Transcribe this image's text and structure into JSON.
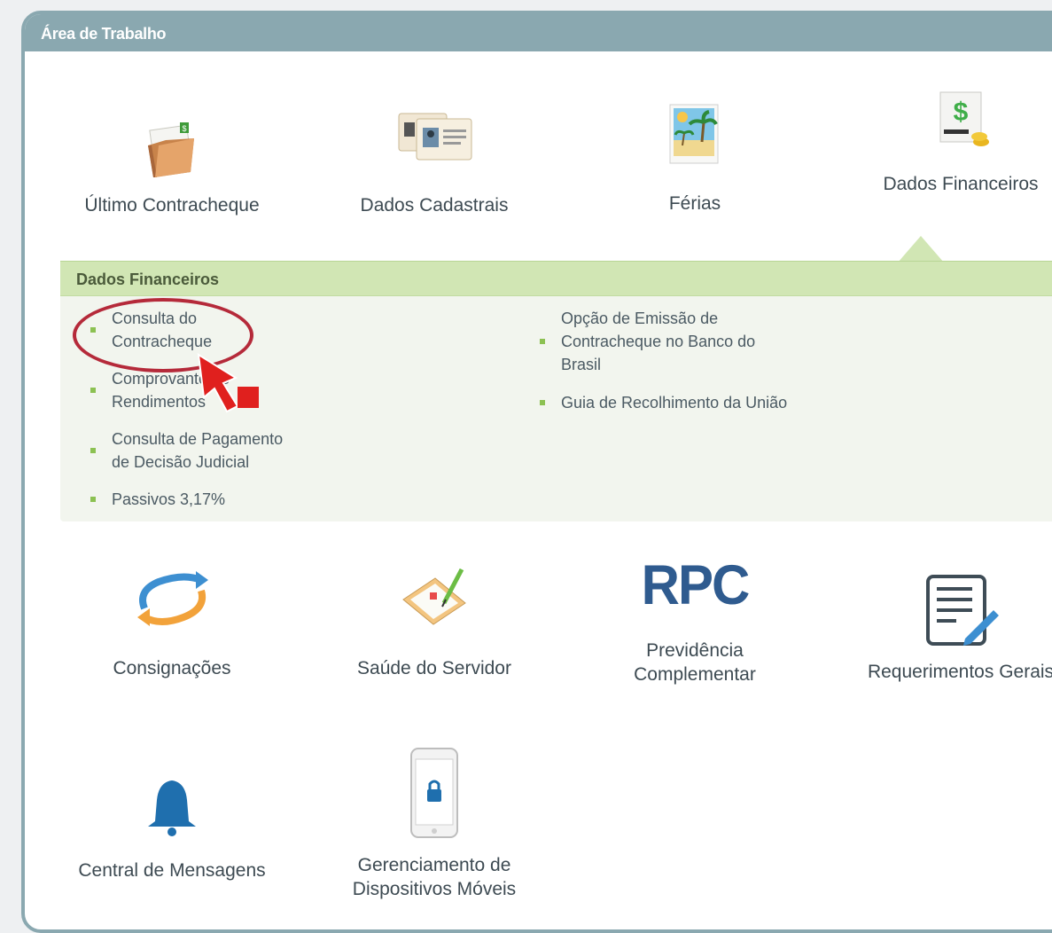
{
  "panel": {
    "title": "Área de Trabalho"
  },
  "tiles_top": [
    {
      "label": "Último Contracheque",
      "icon": "folder-money-icon"
    },
    {
      "label": "Dados Cadastrais",
      "icon": "id-cards-icon"
    },
    {
      "label": "Férias",
      "icon": "beach-photo-icon"
    },
    {
      "label": "Dados Financeiros",
      "icon": "dollar-document-icon"
    }
  ],
  "submenu": {
    "title": "Dados Financeiros",
    "left_items": [
      {
        "line1": "Consulta do",
        "line2": "Contracheque"
      },
      {
        "line1": "Comprovante de",
        "line2": "Rendimentos"
      },
      {
        "line1": "Consulta de Pagamento",
        "line2": "de Decisão Judicial"
      },
      {
        "line1": "Passivos 3,17%",
        "line2": ""
      }
    ],
    "right_items": [
      {
        "line1": "Opção de Emissão de",
        "line2": "Contracheque no Banco do",
        "line3": "Brasil"
      },
      {
        "line1": "Guia de Recolhimento da União",
        "line2": "",
        "line3": ""
      }
    ]
  },
  "tiles_middle": [
    {
      "label": "Consignações",
      "icon": "circular-arrows-icon"
    },
    {
      "label": "Saúde do Servidor",
      "icon": "clipboard-health-icon"
    },
    {
      "line1": "Previdência",
      "line2": "Complementar",
      "logo": "RPC"
    },
    {
      "label": "Requerimentos Gerais",
      "icon": "edit-document-icon"
    }
  ],
  "tiles_bottom": [
    {
      "label": "Central de Mensagens",
      "icon": "bell-icon"
    },
    {
      "line1": "Gerenciamento de",
      "line2": "Dispositivos Móveis",
      "icon": "phone-lock-icon"
    }
  ],
  "colors": {
    "header": "#8aa8b0",
    "submenu_header": "#d1e6b4",
    "bullet": "#8cc152",
    "highlight": "#b52a3a",
    "arrow": "#e0201e",
    "rpc_logo": "#2f5b8f",
    "bell": "#1f6fae"
  }
}
